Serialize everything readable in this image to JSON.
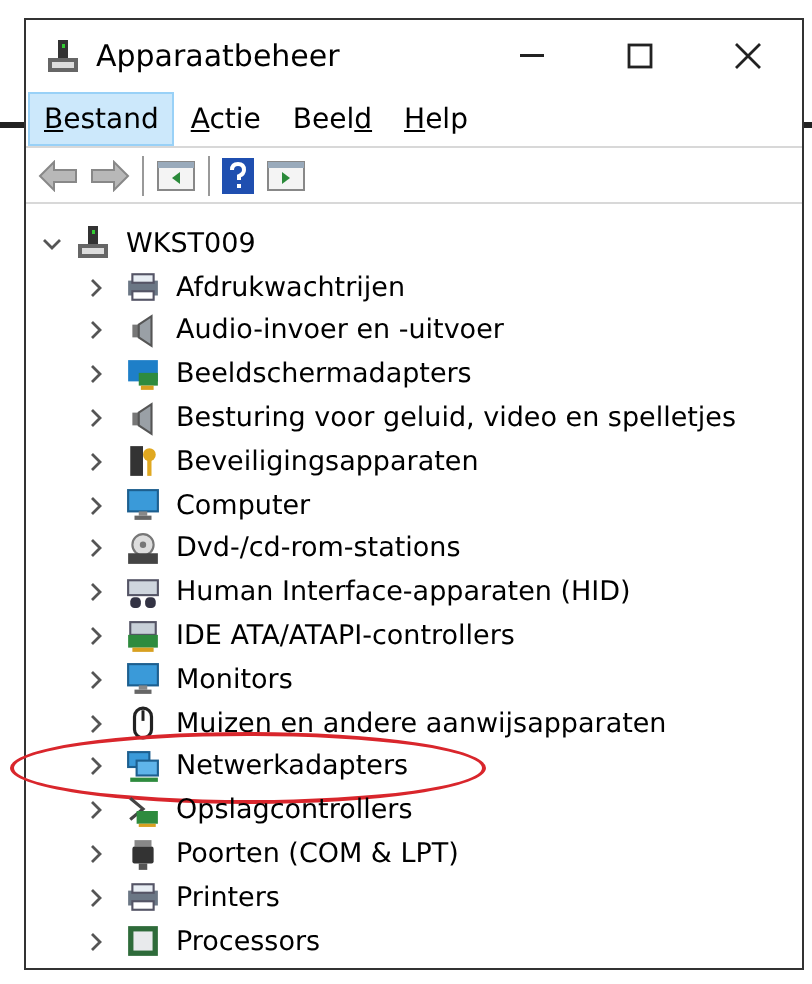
{
  "window": {
    "title": "Apparaatbeheer"
  },
  "menu": [
    {
      "selected": true,
      "parts": [
        {
          "text": "B",
          "underline": true
        },
        {
          "text": "estand",
          "underline": false
        }
      ]
    },
    {
      "selected": false,
      "parts": [
        {
          "text": "A",
          "underline": true
        },
        {
          "text": "ctie",
          "underline": false
        }
      ]
    },
    {
      "selected": false,
      "parts": [
        {
          "text": "Beel",
          "underline": false
        },
        {
          "text": "d",
          "underline": true
        }
      ]
    },
    {
      "selected": false,
      "parts": [
        {
          "text": "H",
          "underline": true
        },
        {
          "text": "elp",
          "underline": false
        }
      ]
    }
  ],
  "tree": {
    "label": "WKST009",
    "expanded": true,
    "children": [
      {
        "label": "Afdrukwachtrijen",
        "kind": "printer",
        "expanded": false,
        "highlighted": false
      },
      {
        "label": "Audio-invoer en -uitvoer",
        "kind": "speaker",
        "expanded": false,
        "highlighted": false
      },
      {
        "label": "Beeldschermadapters",
        "kind": "adapter",
        "expanded": false,
        "highlighted": false
      },
      {
        "label": "Besturing voor geluid, video en spelletjes",
        "kind": "speaker",
        "expanded": false,
        "highlighted": false
      },
      {
        "label": "Beveiligingsapparaten",
        "kind": "key",
        "expanded": false,
        "highlighted": false
      },
      {
        "label": "Computer",
        "kind": "monitor",
        "expanded": false,
        "highlighted": false
      },
      {
        "label": "Dvd-/cd-rom-stations",
        "kind": "disc",
        "expanded": false,
        "highlighted": false
      },
      {
        "label": "Human Interface-apparaten (HID)",
        "kind": "keyboard",
        "expanded": false,
        "highlighted": false
      },
      {
        "label": "IDE ATA/ATAPI-controllers",
        "kind": "board",
        "expanded": false,
        "highlighted": false
      },
      {
        "label": "Monitors",
        "kind": "monitor",
        "expanded": false,
        "highlighted": false
      },
      {
        "label": "Muizen en andere aanwijsapparaten",
        "kind": "mouse",
        "expanded": false,
        "highlighted": false
      },
      {
        "label": "Netwerkadapters",
        "kind": "network",
        "expanded": false,
        "highlighted": true
      },
      {
        "label": "Opslagcontrollers",
        "kind": "storage",
        "expanded": false,
        "highlighted": false
      },
      {
        "label": "Poorten (COM & LPT)",
        "kind": "port",
        "expanded": false,
        "highlighted": false
      },
      {
        "label": "Printers",
        "kind": "printer",
        "expanded": false,
        "highlighted": false
      },
      {
        "label": "Processors",
        "kind": "chip",
        "expanded": false,
        "highlighted": false
      }
    ]
  }
}
